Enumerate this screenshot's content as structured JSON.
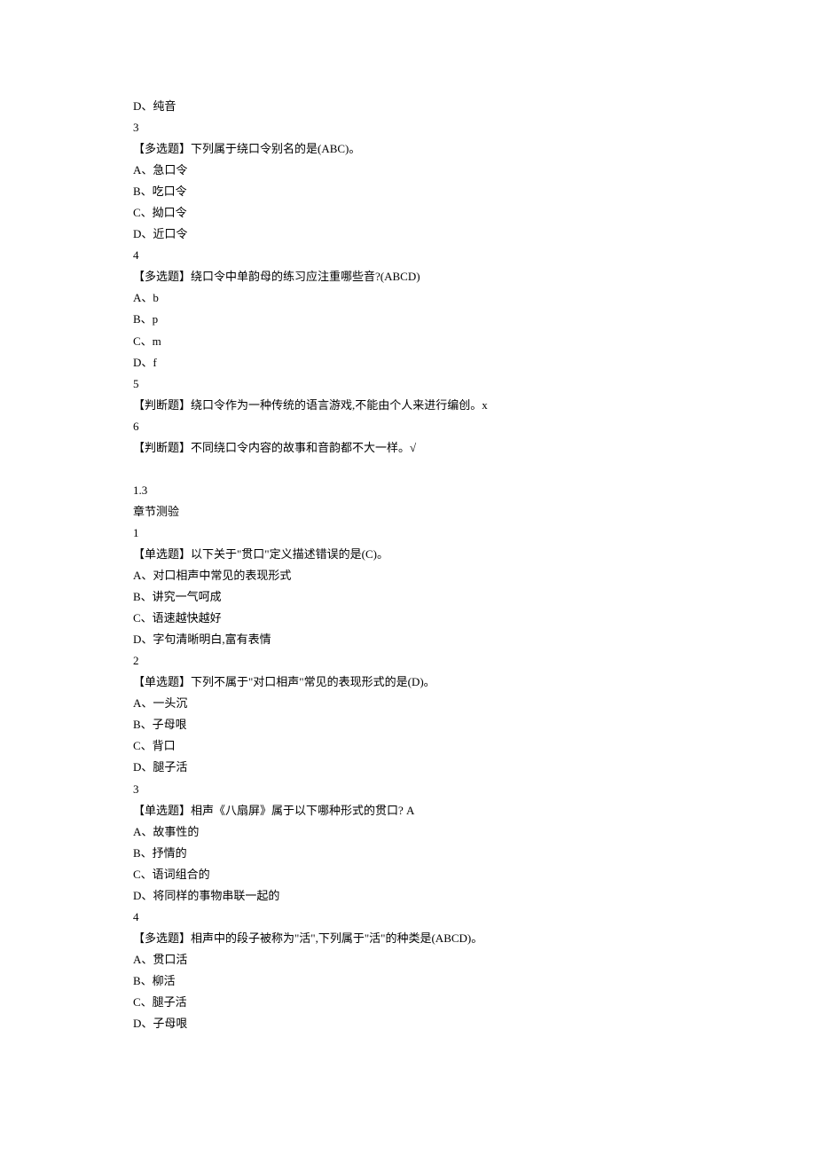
{
  "lines": [
    "D、纯音",
    "3",
    "【多选题】下列属于绕口令别名的是(ABC)。",
    "A、急口令",
    "B、吃口令",
    "C、拗口令",
    "D、近口令",
    "4",
    "【多选题】绕口令中单韵母的练习应注重哪些音?(ABCD)",
    "A、b",
    "B、p",
    "C、m",
    "D、f",
    "5",
    "【判断题】绕口令作为一种传统的语言游戏,不能由个人来进行编创。x",
    "6",
    "【判断题】不同绕口令内容的故事和音韵都不大一样。√",
    "",
    "1.3",
    "章节测验",
    "1",
    "【单选题】以下关于\"贯口\"定义描述错误的是(C)。",
    "A、对口相声中常见的表现形式",
    "B、讲究一气呵成",
    "C、语速越快越好",
    "D、字句清晰明白,富有表情",
    "2",
    "【单选题】下列不属于\"对口相声\"常见的表现形式的是(D)。",
    "A、一头沉",
    "B、子母哏",
    "C、背口",
    "D、腿子活",
    "3",
    "【单选题】相声《八扇屏》属于以下哪种形式的贯口? A",
    "A、故事性的",
    "B、抒情的",
    "C、语词组合的",
    "D、将同样的事物串联一起的",
    "4",
    "【多选题】相声中的段子被称为\"活\",下列属于\"活\"的种类是(ABCD)。",
    "A、贯口活",
    "B、柳活",
    "C、腿子活",
    "D、子母哏"
  ]
}
